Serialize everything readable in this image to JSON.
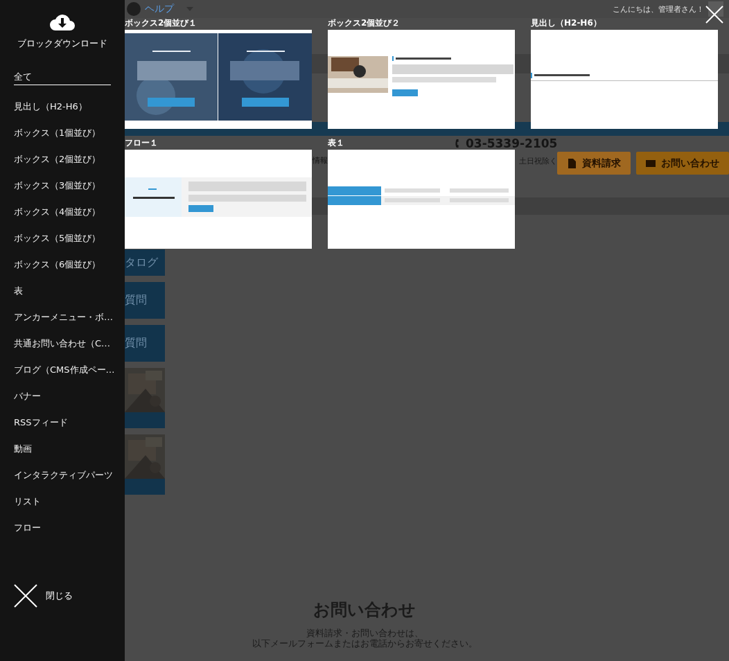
{
  "topbar": {
    "help": "ヘルプ",
    "greeting": "こんにちは、管理者さん！"
  },
  "header": {
    "nav_fragment": "情報",
    "phone": "03-5339-2105",
    "hours": "土日祝除く",
    "buttons": [
      {
        "label": "資料請求",
        "kind": "document"
      },
      {
        "label": "お問い合わせ",
        "kind": "mail"
      }
    ]
  },
  "side_links": [
    {
      "label": "タログ",
      "kind": "button"
    },
    {
      "label": "質問",
      "kind": "button"
    },
    {
      "label": "質問",
      "kind": "button"
    },
    {
      "kind": "banner"
    },
    {
      "kind": "banner"
    }
  ],
  "contact": {
    "title": "お問い合わせ",
    "lines": [
      "資料請求・お問い合わせは、",
      "以下メールフォームまたはお電話からお寄せください。"
    ]
  },
  "download_panel": {
    "title": "ブロックダウンロード",
    "close": "閉じる",
    "categories": [
      {
        "label": "全て",
        "selected": true
      },
      {
        "label": "見出し（H2-H6）",
        "selected": false
      },
      {
        "label": "ボックス（1個並び）",
        "selected": false
      },
      {
        "label": "ボックス（2個並び）",
        "selected": false
      },
      {
        "label": "ボックス（3個並び）",
        "selected": false
      },
      {
        "label": "ボックス（4個並び）",
        "selected": false
      },
      {
        "label": "ボックス（5個並び）",
        "selected": false
      },
      {
        "label": "ボックス（6個並び）",
        "selected": false
      },
      {
        "label": "表",
        "selected": false
      },
      {
        "label": "アンカーメニュー・ボ…",
        "selected": false
      },
      {
        "label": "共通お問い合わせ（C…",
        "selected": false
      },
      {
        "label": "ブログ（CMS作成ペー…",
        "selected": false
      },
      {
        "label": "バナー",
        "selected": false
      },
      {
        "label": "RSSフィード",
        "selected": false
      },
      {
        "label": "動画",
        "selected": false
      },
      {
        "label": "インタラクティブパーツ",
        "selected": false
      },
      {
        "label": "リスト",
        "selected": false
      },
      {
        "label": "フロー",
        "selected": false
      }
    ],
    "blocks": [
      {
        "label": "ボックス2個並び１",
        "kind": "dark"
      },
      {
        "label": "ボックス2個並び２",
        "kind": "image-text"
      },
      {
        "label": "見出し（H2-H6）",
        "kind": "heading"
      },
      {
        "label": "フロー１",
        "kind": "flow"
      },
      {
        "label": "表１",
        "kind": "table"
      }
    ]
  }
}
